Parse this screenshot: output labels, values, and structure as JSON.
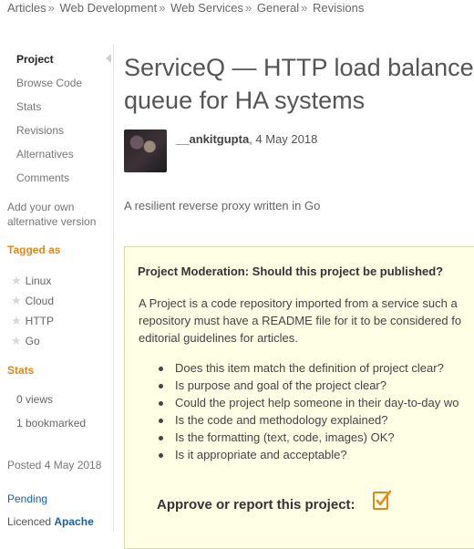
{
  "breadcrumb": [
    "Articles",
    "Web Development",
    "Web Services",
    "General",
    "Revisions"
  ],
  "breadcrumb_separator": "»",
  "sidebar": {
    "nav": [
      "Project",
      "Browse Code",
      "Stats",
      "Revisions",
      "Alternatives",
      "Comments"
    ],
    "alternative_line1": "Add your own",
    "alternative_line2": "alternative version",
    "tagged_heading": "Tagged as",
    "tags": [
      "Linux",
      "Cloud",
      "HTTP",
      "Go"
    ],
    "stats_heading": "Stats",
    "views": "0 views",
    "bookmarked": "1 bookmarked",
    "posted": "Posted 4 May 2018",
    "status": "Pending",
    "licence_label": "Licenced",
    "licence_value": "Apache"
  },
  "article": {
    "title_line1": "ServiceQ — HTTP load balancer",
    "title_line2": "queue for HA systems",
    "author": "__ankitgupta",
    "date": ", 4 May 2018",
    "summary": "A resilient reverse proxy written in Go"
  },
  "moderation": {
    "title": "Project Moderation: Should this project be published?",
    "para_line1": "A Project is a code repository imported from a service such a",
    "para_line2": "repository must have a README file for it to be considered fo",
    "para_line3": "editorial guidelines for articles.",
    "checklist": [
      "Does this item match the definition of project clear?",
      "Is purpose and goal of the project clear?",
      "Could the project help someone in their day-to-day wo",
      "Is the code and methodology explained?",
      "Is the formatting (text, code, images) OK?",
      "Is it appropriate and acceptable?"
    ],
    "approve_label": "Approve or report this project:"
  },
  "colors": {
    "accent_orange": "#e08a1e",
    "link_blue": "#1a5fa6",
    "moderation_bg": "#ffffe6"
  }
}
